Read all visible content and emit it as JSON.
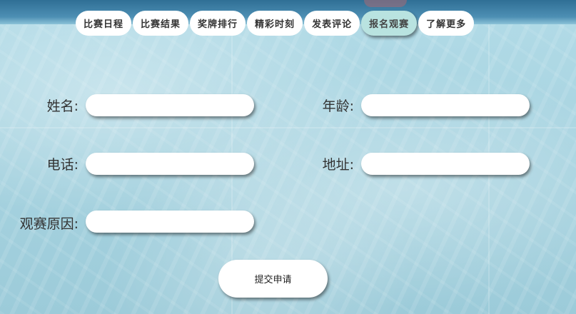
{
  "nav": {
    "tabs": [
      {
        "label": "比赛日程"
      },
      {
        "label": "比赛结果"
      },
      {
        "label": "奖牌排行"
      },
      {
        "label": "精彩时刻"
      },
      {
        "label": "发表评论"
      },
      {
        "label": "报名观赛"
      },
      {
        "label": "了解更多"
      }
    ],
    "active_index": 5
  },
  "form": {
    "name": {
      "label": "姓名:",
      "value": ""
    },
    "age": {
      "label": "年龄:",
      "value": ""
    },
    "phone": {
      "label": "电话:",
      "value": ""
    },
    "address": {
      "label": "地址:",
      "value": ""
    },
    "reason": {
      "label": "观赛原因:",
      "value": ""
    },
    "submit_label": "提交申请"
  },
  "colors": {
    "background": "#a8d3e0",
    "tab_active": "#b9e3e0",
    "field_bg": "#ffffff"
  }
}
